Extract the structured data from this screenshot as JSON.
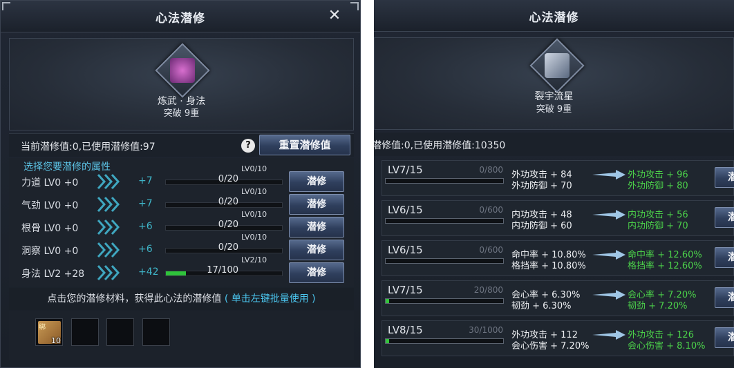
{
  "left": {
    "title": "心法潜修",
    "close": "✕",
    "skill": {
      "name": "炼武 · 身法",
      "level": "突破 9重"
    },
    "info": "当前潜修值:0,已使用潜修值:97",
    "help": "?",
    "reset_label": "重置潜修值",
    "attr_header": "选择您要潜修的属性",
    "attrs": [
      {
        "name": "力道 LV0 +0",
        "inc": "+7",
        "lv": "LV0/10",
        "val": "0/20",
        "progress": 0
      },
      {
        "name": "气劲 LV0 +0",
        "inc": "+7",
        "lv": "LV0/10",
        "val": "0/20",
        "progress": 0
      },
      {
        "name": "根骨 LV0 +0",
        "inc": "+6",
        "lv": "LV0/10",
        "val": "0/20",
        "progress": 0
      },
      {
        "name": "洞察 LV0 +0",
        "inc": "+6",
        "lv": "LV0/10",
        "val": "0/20",
        "progress": 0
      },
      {
        "name": "身法 LV2 +28",
        "inc": "+42",
        "lv": "LV2/10",
        "val": "17/100",
        "progress": 0.17
      }
    ],
    "button_label": "潜修",
    "hint_main": "点击您的潜修材料，获得此心法的潜修值",
    "hint_link": "( 单击左键批量使用 )",
    "item": {
      "badge": "绑",
      "count": "10"
    }
  },
  "right": {
    "title": "心法潜修",
    "skill": {
      "name": "裂宇流星",
      "level": "突破 9重"
    },
    "info": "潜修值:0,已使用潜修值:10350",
    "button_label": "潜修",
    "rows": [
      {
        "level": "LV7/15",
        "exp": "0/800",
        "progress": 0,
        "cur": [
          "外功攻击 + 84",
          "外功防御 + 70"
        ],
        "next": [
          "外功攻击 + 96",
          "外功防御 + 80"
        ]
      },
      {
        "level": "LV6/15",
        "exp": "0/600",
        "progress": 0,
        "cur": [
          "内功攻击 + 48",
          "内功防御 + 60"
        ],
        "next": [
          "内功攻击 + 56",
          "内功防御 + 70"
        ]
      },
      {
        "level": "LV6/15",
        "exp": "0/600",
        "progress": 0,
        "cur": [
          "命中率 + 10.80%",
          "格挡率 + 10.80%"
        ],
        "next": [
          "命中率 + 12.60%",
          "格挡率 + 12.60%"
        ]
      },
      {
        "level": "LV7/15",
        "exp": "20/800",
        "progress": 0.025,
        "cur": [
          "会心率 + 6.30%",
          "韧劲 + 6.30%"
        ],
        "next": [
          "会心率 + 7.20%",
          "韧劲 + 7.20%"
        ]
      },
      {
        "level": "LV8/15",
        "exp": "30/1000",
        "progress": 0.03,
        "cur": [
          "外功攻击 + 112",
          "会心伤害 + 7.20%"
        ],
        "next": [
          "外功攻击 + 126",
          "会心伤害 + 8.10%"
        ]
      }
    ]
  },
  "colors": {
    "accent_cyan": "#3fb6c9",
    "next_green": "#4cd34a",
    "bar_green": "#2fc43b"
  }
}
